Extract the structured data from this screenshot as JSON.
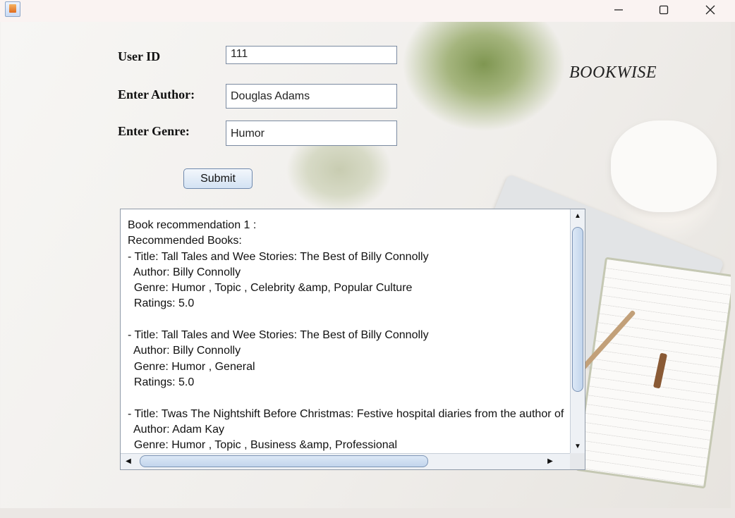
{
  "window": {
    "controls": [
      "minimize-icon",
      "maximize-icon",
      "close-icon"
    ]
  },
  "brand": "BOOKWISE",
  "form": {
    "user_id_label": "User ID",
    "user_id_value": "111",
    "author_label": "Enter Author:",
    "author_value": "Douglas Adams",
    "genre_label": "Enter Genre:",
    "genre_value": "Humor",
    "submit_label": "Submit"
  },
  "results": {
    "text": "Book recommendation 1 :\nRecommended Books:\n- Title: Tall Tales and Wee Stories: The Best of Billy Connolly\n  Author: Billy Connolly\n  Genre: Humor , Topic , Celebrity &amp, Popular Culture\n  Ratings: 5.0\n\n- Title: Tall Tales and Wee Stories: The Best of Billy Connolly\n  Author: Billy Connolly\n  Genre: Humor , General\n  Ratings: 5.0\n\n- Title: Twas The Nightshift Before Christmas: Festive hospital diaries from the author of\n  Author: Adam Kay\n  Genre: Humor , Topic , Business &amp, Professional"
  }
}
